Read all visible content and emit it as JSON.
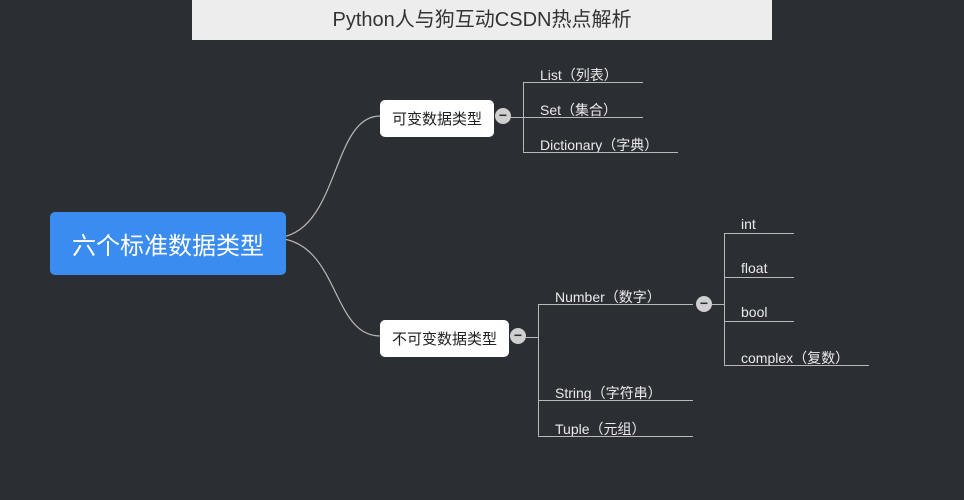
{
  "header": {
    "title": "Python人与狗互动CSDN热点解析"
  },
  "mindmap": {
    "root": {
      "label": "六个标准数据类型"
    },
    "branches": [
      {
        "label": "可变数据类型",
        "collapse_glyph": "−",
        "children": [
          {
            "label": "List（列表）"
          },
          {
            "label": "Set（集合）"
          },
          {
            "label": "Dictionary（字典）"
          }
        ]
      },
      {
        "label": "不可变数据类型",
        "collapse_glyph": "−",
        "children": [
          {
            "label": "Number（数字）",
            "collapse_glyph": "−",
            "children": [
              {
                "label": "int"
              },
              {
                "label": "float"
              },
              {
                "label": "bool"
              },
              {
                "label": "complex（复数）"
              }
            ]
          },
          {
            "label": "String（字符串）"
          },
          {
            "label": "Tuple（元组）"
          }
        ]
      }
    ]
  }
}
